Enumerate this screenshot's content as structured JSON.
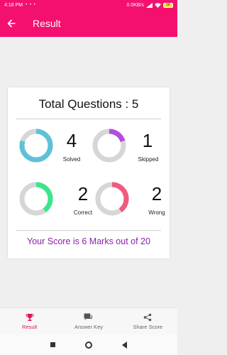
{
  "status_bar": {
    "time": "4:18 PM",
    "dots": "• • •",
    "net_speed": "0.0KB/s",
    "battery": "58"
  },
  "app_bar": {
    "title": "Result"
  },
  "result": {
    "total_label": "Total Questions : 5",
    "stats": [
      {
        "key": "solved",
        "value": "4",
        "label": "Solved",
        "color": "#5fc1d8",
        "fraction": 0.8
      },
      {
        "key": "skipped",
        "value": "1",
        "label": "Skipped",
        "color": "#b44de0",
        "fraction": 0.2
      },
      {
        "key": "correct",
        "value": "2",
        "label": "Correct",
        "color": "#3be58c",
        "fraction": 0.4
      },
      {
        "key": "wrong",
        "value": "2",
        "label": "Wrong",
        "color": "#f05a7e",
        "fraction": 0.4
      }
    ],
    "score_text": "Your Score is 6 Marks out of 20"
  },
  "bottom_nav": {
    "items": [
      {
        "label": "Result",
        "icon": "trophy-icon",
        "active": true
      },
      {
        "label": "Answer Key",
        "icon": "chat-icon",
        "active": false
      },
      {
        "label": "Share Score",
        "icon": "share-icon",
        "active": false
      }
    ]
  },
  "colors": {
    "brand": "#f4106e",
    "score_text": "#8a1fa8",
    "ring_track": "#d6d6d6"
  }
}
